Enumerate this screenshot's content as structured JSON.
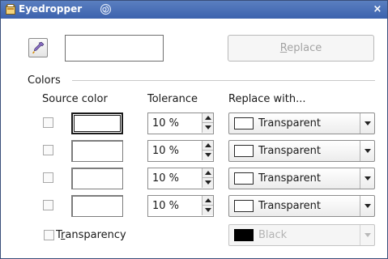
{
  "window": {
    "title": "Eyedropper",
    "close_glyph": "×",
    "icons": [
      "window-icon",
      "spiral-icon",
      "close-icon"
    ]
  },
  "toolbar": {
    "pipette_icon": "pipette-icon",
    "replace_label_prefix": "",
    "replace_label_mnemonic": "R",
    "replace_label_suffix": "eplace",
    "replace_enabled": false
  },
  "colors": {
    "section_label": "Colors",
    "headers": {
      "source": "Source color",
      "tolerance": "Tolerance",
      "replace_with": "Replace with..."
    },
    "rows": [
      {
        "checked": false,
        "source_selected": true,
        "tolerance": "10 %",
        "replace": "Transparent"
      },
      {
        "checked": false,
        "source_selected": false,
        "tolerance": "10 %",
        "replace": "Transparent"
      },
      {
        "checked": false,
        "source_selected": false,
        "tolerance": "10 %",
        "replace": "Transparent"
      },
      {
        "checked": false,
        "source_selected": false,
        "tolerance": "10 %",
        "replace": "Transparent"
      }
    ]
  },
  "transparency": {
    "label_prefix": "T",
    "label_mnemonic": "r",
    "label_suffix": "ansparency",
    "checked": false,
    "color_label": "Black",
    "color_swatch": "#000000",
    "enabled": false
  },
  "palette": {
    "titlebar_top": "#5a7fc0",
    "titlebar_bottom": "#3c62ad",
    "disabled_text": "#a4a4a4"
  }
}
